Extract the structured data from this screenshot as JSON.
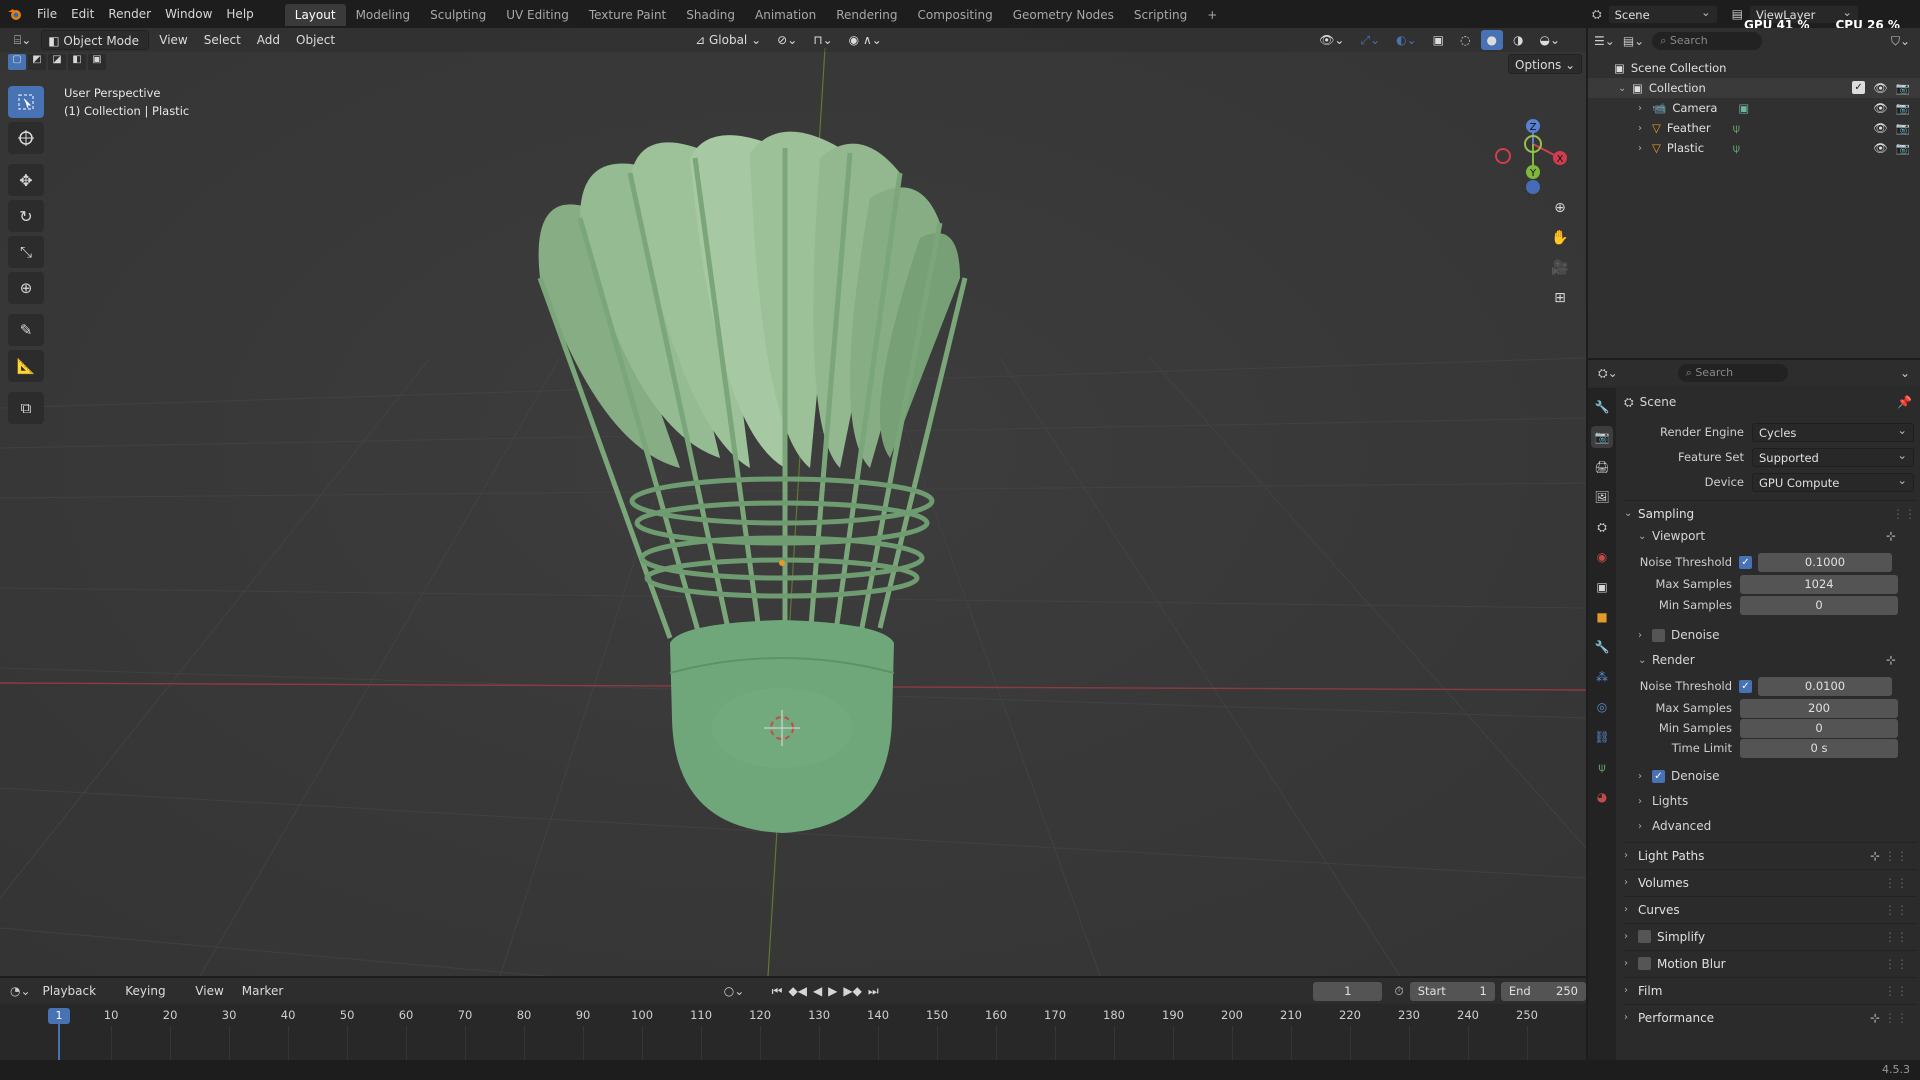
{
  "topbar": {
    "menus": [
      "File",
      "Edit",
      "Render",
      "Window",
      "Help"
    ],
    "workspaces": [
      "Layout",
      "Modeling",
      "Sculpting",
      "UV Editing",
      "Texture Paint",
      "Shading",
      "Animation",
      "Rendering",
      "Compositing",
      "Geometry Nodes",
      "Scripting"
    ],
    "active_workspace": "Layout",
    "scene_name": "Scene",
    "view_layer": "ViewLayer",
    "gpu_label": "GPU 41 %",
    "cpu_label": "CPU 26 %"
  },
  "viewport": {
    "mode": "Object Mode",
    "menus": [
      "View",
      "Select",
      "Add",
      "Object"
    ],
    "transform_orientation": "Global",
    "options_label": "Options",
    "perspective_label": "User Perspective",
    "collection_label": "(1) Collection | Plastic",
    "axis_labels": {
      "x": "X",
      "y": "Y",
      "z": "Z"
    },
    "object_color": "#6fa77a"
  },
  "outliner": {
    "search_placeholder": "Search",
    "scene_collection": "Scene Collection",
    "collection": "Collection",
    "items": [
      {
        "name": "Camera",
        "icon": "camera-icon"
      },
      {
        "name": "Feather",
        "icon": "mesh-icon"
      },
      {
        "name": "Plastic",
        "icon": "mesh-icon"
      }
    ]
  },
  "properties": {
    "search_placeholder": "Search",
    "context_title": "Scene",
    "render_engine_label": "Render Engine",
    "render_engine": "Cycles",
    "feature_set_label": "Feature Set",
    "feature_set": "Supported",
    "device_label": "Device",
    "device": "GPU Compute",
    "sampling_label": "Sampling",
    "viewport_label": "Viewport",
    "viewport_noise_threshold_label": "Noise Threshold",
    "viewport_noise_threshold": "0.1000",
    "viewport_max_samples_label": "Max Samples",
    "viewport_max_samples": "1024",
    "viewport_min_samples_label": "Min Samples",
    "viewport_min_samples": "0",
    "viewport_denoise_label": "Denoise",
    "render_label": "Render",
    "render_noise_threshold_label": "Noise Threshold",
    "render_noise_threshold": "0.0100",
    "render_max_samples_label": "Max Samples",
    "render_max_samples": "200",
    "render_min_samples_label": "Min Samples",
    "render_min_samples": "0",
    "time_limit_label": "Time Limit",
    "time_limit": "0 s",
    "render_denoise_label": "Denoise",
    "lights_label": "Lights",
    "advanced_label": "Advanced",
    "panels": [
      "Light Paths",
      "Volumes",
      "Curves",
      "Simplify",
      "Motion Blur",
      "Film",
      "Performance"
    ]
  },
  "timeline": {
    "menus": [
      "Playback",
      "Keying",
      "View",
      "Marker"
    ],
    "current_frame": "1",
    "start_label": "Start",
    "start": "1",
    "end_label": "End",
    "end": "250",
    "ticks": [
      "1",
      "10",
      "20",
      "30",
      "40",
      "50",
      "60",
      "70",
      "80",
      "90",
      "100",
      "110",
      "120",
      "130",
      "140",
      "150",
      "160",
      "170",
      "180",
      "190",
      "200",
      "210",
      "220",
      "230",
      "240",
      "250"
    ]
  },
  "status": {
    "version": "4.5.3"
  }
}
